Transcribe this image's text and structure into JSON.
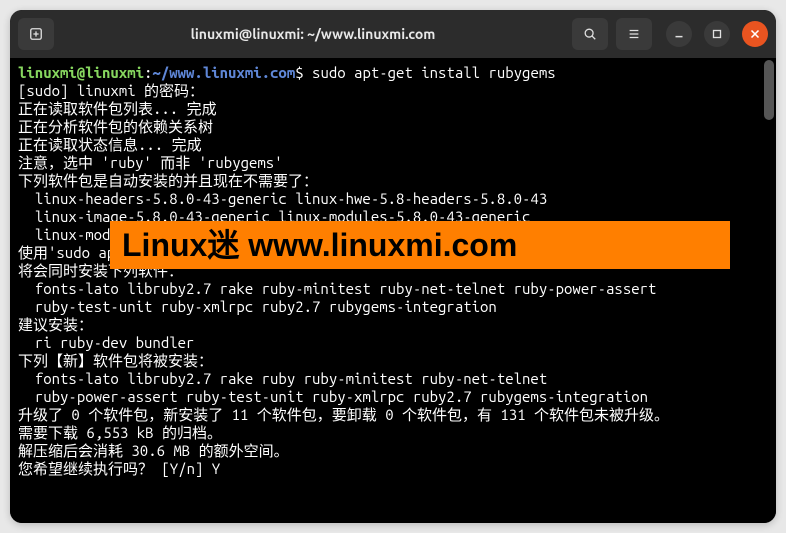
{
  "titlebar": {
    "title": "linuxmi@linuxmi: ~/www.linuxmi.com"
  },
  "prompt": {
    "user_host": "linuxmi@linuxmi",
    "separator": ":",
    "path": "~/www.linuxmi.com",
    "dollar": "$ ",
    "command": "sudo apt-get install rubygems"
  },
  "output": {
    "l1": "[sudo] linuxmi 的密码：",
    "l2": "正在读取软件包列表... 完成",
    "l3": "正在分析软件包的依赖关系树",
    "l4": "正在读取状态信息... 完成",
    "l5": "注意，选中 'ruby' 而非 'rubygems'",
    "l6": "下列软件包是自动安装的并且现在不需要了：",
    "l7": "  linux-headers-5.8.0-43-generic linux-hwe-5.8-headers-5.8.0-43",
    "l8": "  linux-image-5.8.0-43-generic linux-modules-5.8.0-43-generic",
    "l9": "  linux-modules-extra-5.8.0-43-generic",
    "l10": "使用'sudo apt autoremove'来卸载它(它们)。",
    "l11": "将会同时安装下列软件：",
    "l12": "  fonts-lato libruby2.7 rake ruby-minitest ruby-net-telnet ruby-power-assert",
    "l13": "  ruby-test-unit ruby-xmlrpc ruby2.7 rubygems-integration",
    "l14": "建议安装：",
    "l15": "  ri ruby-dev bundler",
    "l16": "下列【新】软件包将被安装：",
    "l17": "  fonts-lato libruby2.7 rake ruby ruby-minitest ruby-net-telnet",
    "l18": "  ruby-power-assert ruby-test-unit ruby-xmlrpc ruby2.7 rubygems-integration",
    "l19": "升级了 0 个软件包，新安装了 11 个软件包，要卸载 0 个软件包，有 131 个软件包未被升级。",
    "l20": "需要下载 6,553 kB 的归档。",
    "l21": "解压缩后会消耗 30.6 MB 的额外空间。",
    "l22": "您希望继续执行吗？ [Y/n] Y"
  },
  "watermark": {
    "text": "Linux迷 www.linuxmi.com"
  }
}
